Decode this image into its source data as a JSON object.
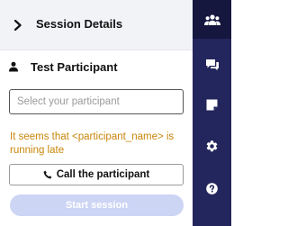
{
  "header": {
    "title": "Session Details",
    "collapse_icon": "chevron-right-icon"
  },
  "participant": {
    "icon": "person-icon",
    "name": "Test Participant"
  },
  "participant_select": {
    "placeholder": "Select your participant"
  },
  "warning": {
    "text": "It seems that <participant_name> is running late",
    "color": "#c8860a"
  },
  "call_button": {
    "label": "Call the participant",
    "icon": "phone-icon"
  },
  "start_button": {
    "label": "Start session",
    "disabled": true
  },
  "rail": {
    "background": "#23265c",
    "items": [
      {
        "icon": "participants-icon",
        "active": true
      },
      {
        "icon": "chat-icon",
        "active": false
      },
      {
        "icon": "note-icon",
        "active": false
      },
      {
        "icon": "gear-icon",
        "active": false
      },
      {
        "icon": "help-icon",
        "active": false
      }
    ]
  }
}
